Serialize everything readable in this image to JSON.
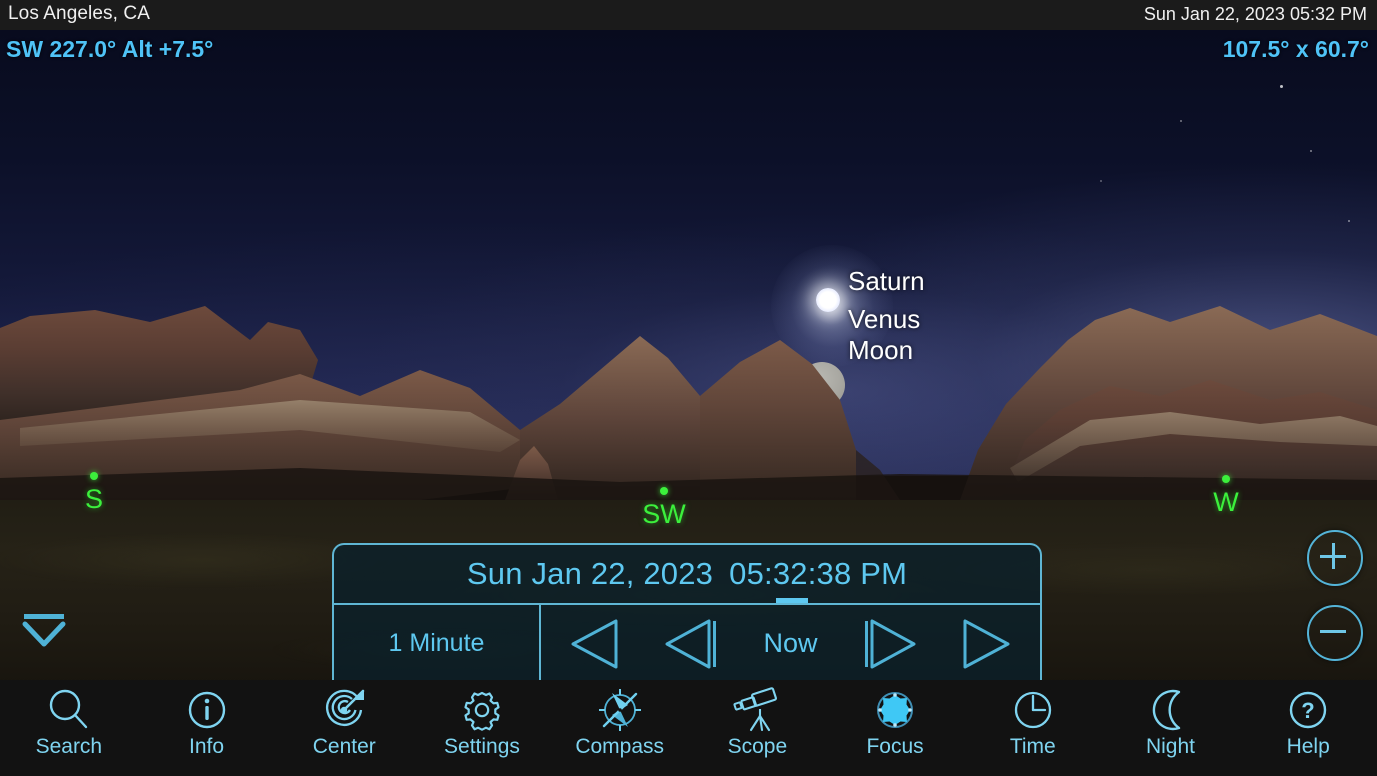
{
  "status_bar": {
    "location": "Los Angeles, CA",
    "datetime": "Sun Jan 22, 2023  05:32 PM"
  },
  "readouts": {
    "direction_altitude": "SW 227.0° Alt +7.5°",
    "field_of_view": "107.5° x 60.7°"
  },
  "sky_objects": [
    {
      "name": "Saturn",
      "label": "Saturn"
    },
    {
      "name": "Venus",
      "label": "Venus"
    },
    {
      "name": "Moon",
      "label": "Moon"
    }
  ],
  "cardinals": [
    {
      "label": "S"
    },
    {
      "label": "SW"
    },
    {
      "label": "W"
    }
  ],
  "time_panel": {
    "date": "Sun Jan 22, 2023",
    "time": "05:32:38 PM",
    "step_label": "1 Minute",
    "now_label": "Now",
    "buttons": [
      {
        "name": "play-reverse",
        "label": "Play Reverse"
      },
      {
        "name": "step-back",
        "label": "Step Back"
      },
      {
        "name": "now",
        "label": "Now"
      },
      {
        "name": "step-forward",
        "label": "Step Forward"
      },
      {
        "name": "play-forward",
        "label": "Play Forward"
      }
    ]
  },
  "zoom_controls": {
    "zoom_in": "+",
    "zoom_out": "−"
  },
  "toolbar": {
    "items": [
      {
        "label": "Search",
        "icon": "search-icon"
      },
      {
        "label": "Info",
        "icon": "info-icon"
      },
      {
        "label": "Center",
        "icon": "center-target-icon"
      },
      {
        "label": "Settings",
        "icon": "gear-icon"
      },
      {
        "label": "Compass",
        "icon": "compass-icon"
      },
      {
        "label": "Scope",
        "icon": "telescope-icon"
      },
      {
        "label": "Focus",
        "icon": "focus-icon"
      },
      {
        "label": "Time",
        "icon": "clock-icon"
      },
      {
        "label": "Night",
        "icon": "moon-icon"
      },
      {
        "label": "Help",
        "icon": "question-icon"
      }
    ]
  },
  "colors": {
    "accent_blue": "#5ec8f0",
    "cardinal_green": "#3cf03c",
    "toolbar_bg": "#121212",
    "statusbar_bg": "#1b1b1b"
  }
}
